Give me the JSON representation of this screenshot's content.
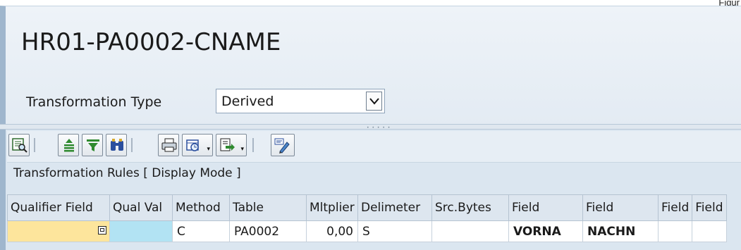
{
  "corner_text": "Figur",
  "header": {
    "title": "HR01-PA0002-CNAME",
    "transformation_type_label": "Transformation Type",
    "transformation_type_value": "Derived"
  },
  "toolbar": {
    "buttons": [
      "details-icon",
      "sort-ascending-icon",
      "filter-icon",
      "find-icon",
      "print-icon",
      "views-icon",
      "export-icon",
      "change-layout-icon"
    ]
  },
  "rules": {
    "title": "Transformation Rules [ Display Mode ]",
    "columns": [
      "Qualifier Field",
      "Qual Val",
      "Method",
      "Table",
      "Mltplier",
      "Delimeter",
      "Src.Bytes",
      "Field",
      "Field",
      "Field",
      "Field"
    ],
    "rows": [
      [
        "",
        "",
        "C",
        "PA0002",
        "0,00",
        "S",
        "",
        "VORNA",
        "NACHN",
        "",
        ""
      ]
    ]
  },
  "colors": {
    "required_field": "#fde59c",
    "readonly_field": "#b2e3f3",
    "panel_border": "#9fb6cd"
  }
}
